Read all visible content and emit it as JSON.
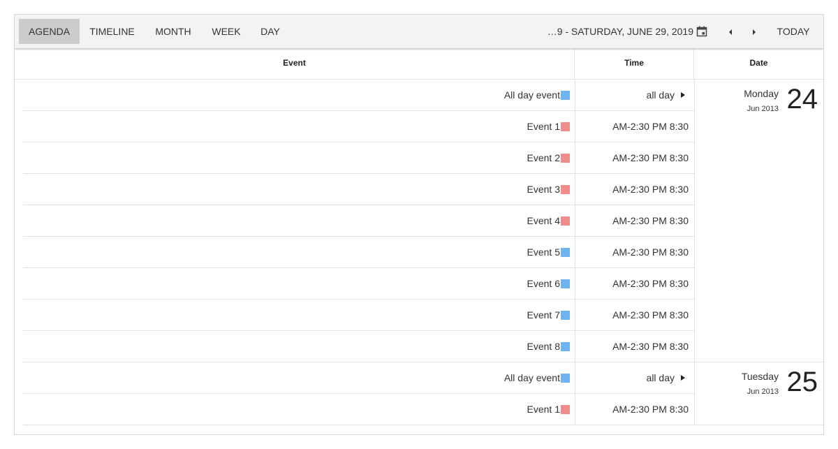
{
  "toolbar": {
    "views": [
      "AGENDA",
      "TIMELINE",
      "MONTH",
      "WEEK",
      "DAY"
    ],
    "active_view": "AGENDA",
    "date_range": "…9 - SATURDAY, JUNE 29, 2019",
    "calendar_icon": "calendar-icon",
    "prev_icon": "chevron-left-icon",
    "next_icon": "chevron-right-icon",
    "today_label": "TODAY"
  },
  "header": {
    "event": "Event",
    "time": "Time",
    "date": "Date"
  },
  "colors": {
    "blue": "#6fb3f2",
    "red": "#f08c8c",
    "active_tab": "#cccccc",
    "toolbar_bg": "#f3f3f3"
  },
  "days": [
    {
      "weekday": "Monday",
      "monthyear": "Jun 2013",
      "day": "24",
      "events": [
        {
          "name": "All day event",
          "color": "blue",
          "time": "all day",
          "allday": true
        },
        {
          "name": "Event 1",
          "color": "red",
          "time": "AM-2:30 PM 8:30",
          "allday": false
        },
        {
          "name": "Event 2",
          "color": "red",
          "time": "AM-2:30 PM 8:30",
          "allday": false
        },
        {
          "name": "Event 3",
          "color": "red",
          "time": "AM-2:30 PM 8:30",
          "allday": false
        },
        {
          "name": "Event 4",
          "color": "red",
          "time": "AM-2:30 PM 8:30",
          "allday": false
        },
        {
          "name": "Event 5",
          "color": "blue",
          "time": "AM-2:30 PM 8:30",
          "allday": false
        },
        {
          "name": "Event 6",
          "color": "blue",
          "time": "AM-2:30 PM 8:30",
          "allday": false
        },
        {
          "name": "Event 7",
          "color": "blue",
          "time": "AM-2:30 PM 8:30",
          "allday": false
        },
        {
          "name": "Event 8",
          "color": "blue",
          "time": "AM-2:30 PM 8:30",
          "allday": false
        }
      ]
    },
    {
      "weekday": "Tuesday",
      "monthyear": "Jun 2013",
      "day": "25",
      "events": [
        {
          "name": "All day event",
          "color": "blue",
          "time": "all day",
          "allday": true
        },
        {
          "name": "Event 1",
          "color": "red",
          "time": "AM-2:30 PM 8:30",
          "allday": false
        }
      ]
    }
  ]
}
